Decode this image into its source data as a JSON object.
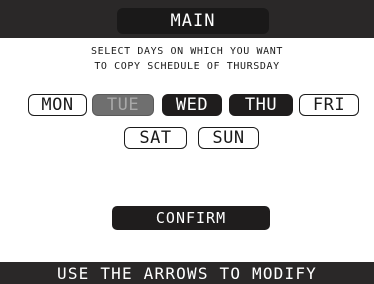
{
  "header": {
    "title": "MAIN"
  },
  "instruction": {
    "line1": "SELECT DAYS ON WHICH YOU WANT",
    "line2": "TO COPY SCHEDULE OF THURSDAY"
  },
  "days": [
    {
      "label": "MON",
      "state": "unselected"
    },
    {
      "label": "TUE",
      "state": "disabled"
    },
    {
      "label": "WED",
      "state": "selected"
    },
    {
      "label": "THU",
      "state": "selected"
    },
    {
      "label": "FRI",
      "state": "unselected"
    },
    {
      "label": "SAT",
      "state": "unselected"
    },
    {
      "label": "SUN",
      "state": "unselected"
    }
  ],
  "confirm_label": "CONFIRM",
  "footer": {
    "hint": "USE THE ARROWS TO MODIFY"
  },
  "colors": {
    "bar": "#2a2828",
    "selected": "#1f1d1d",
    "disabled": "#6f6f6f",
    "background": "#ffffff"
  }
}
